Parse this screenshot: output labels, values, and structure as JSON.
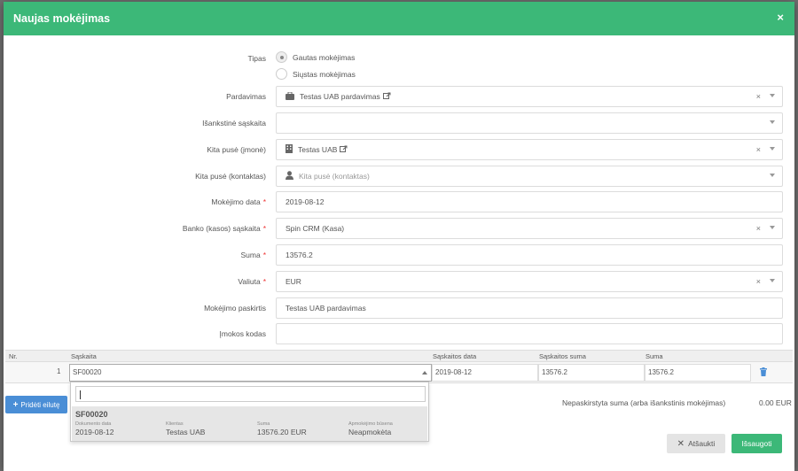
{
  "modal": {
    "title": "Naujas mokėjimas",
    "close_glyph": "×"
  },
  "form": {
    "type_label": "Tipas",
    "type_options": [
      "Gautas mokėjimas",
      "Siųstas mokėjimas"
    ],
    "sale_label": "Pardavimas",
    "sale_value": "Testas UAB pardavimas",
    "prepay_label": "Išankstinė sąskaita",
    "company_label": "Kita pusė (įmonė)",
    "company_value": "Testas UAB",
    "contact_label": "Kita pusė (kontaktas)",
    "contact_placeholder": "Kita pusė (kontaktas)",
    "date_label": "Mokėjimo data",
    "date_value": "2019-08-12",
    "bank_label": "Banko (kasos) sąskaita",
    "bank_value": "Spin CRM (Kasa)",
    "amount_label": "Suma",
    "amount_value": "13576.2",
    "currency_label": "Valiuta",
    "currency_value": "EUR",
    "purpose_label": "Mokėjimo paskirtis",
    "purpose_value": "Testas UAB pardavimas",
    "code_label": "Įmokos kodas",
    "code_value": "",
    "required_mark": "*",
    "clear_glyph": "×"
  },
  "table": {
    "headers": [
      "Nr.",
      "Sąskaita",
      "Sąskaitos data",
      "Sąskaitos suma",
      "Suma"
    ],
    "row": {
      "nr": "1",
      "invoice": "SF00020",
      "date": "2019-08-12",
      "invoice_sum": "13576.2",
      "sum": "13576.2"
    }
  },
  "dropdown": {
    "option": {
      "code": "SF00020",
      "doc_date_label": "Dokumento data",
      "doc_date": "2019-08-12",
      "client_label": "Klientas",
      "client": "Testas UAB",
      "sum_label": "Suma",
      "sum": "13576.20 EUR",
      "status_label": "Apmokėjimo būsena",
      "status": "Neapmokėta"
    }
  },
  "footer": {
    "add_row_label": "Pridėti eilutę",
    "unallocated_label": "Nepaskirstyta suma (arba išankstinis mokėjimas)",
    "unallocated_value": "0.00 EUR",
    "cancel_label": "Atšaukti",
    "save_label": "Išsaugoti"
  },
  "colors": {
    "header": "#3cb878",
    "primary_button": "#4a8ed6",
    "trash": "#4a8ed6"
  }
}
